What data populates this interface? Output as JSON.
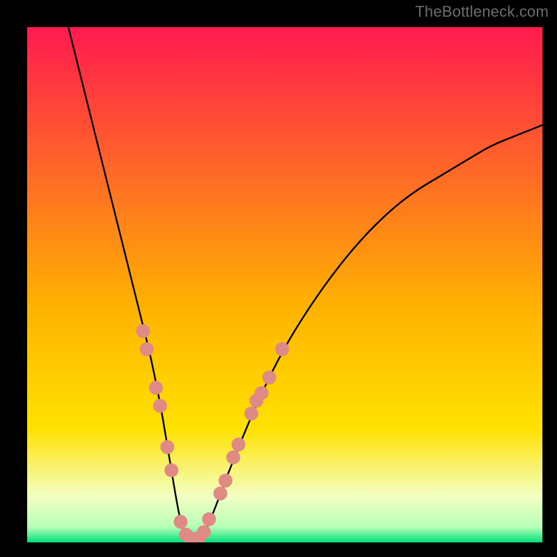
{
  "watermark": "TheBottleneck.com",
  "colors": {
    "frame": "#000000",
    "grad_top": "#ff1a4f",
    "grad_mid": "#ffe200",
    "grad_bottom1": "#e8ffb0",
    "grad_bottom2": "#00e07a",
    "curve": "#000000",
    "marker": "#e08a86"
  },
  "chart_data": {
    "type": "line",
    "title": "",
    "xlabel": "",
    "ylabel": "",
    "xlim": [
      0,
      100
    ],
    "ylim": [
      0,
      100
    ],
    "legend": false,
    "series": [
      {
        "name": "bottleneck-curve",
        "x": [
          8,
          10,
          12,
          14,
          16,
          18,
          20,
          22,
          24,
          26,
          27,
          28,
          29,
          30,
          31,
          32,
          33,
          34,
          35,
          37,
          40,
          45,
          50,
          55,
          60,
          65,
          70,
          75,
          80,
          85,
          90,
          95,
          100
        ],
        "y": [
          100,
          92,
          84,
          76,
          68,
          60,
          52,
          44,
          36,
          26,
          20,
          14,
          8,
          3,
          1,
          0.5,
          0.5,
          1,
          3,
          8,
          16,
          28,
          38,
          46,
          53,
          59,
          64,
          68,
          71,
          74,
          77,
          79,
          81
        ]
      }
    ],
    "markers": {
      "name": "highlight-dots",
      "color": "#e08a86",
      "points": [
        {
          "x": 22.5,
          "y": 41
        },
        {
          "x": 23.2,
          "y": 37.5
        },
        {
          "x": 25.0,
          "y": 30
        },
        {
          "x": 25.8,
          "y": 26.5
        },
        {
          "x": 27.2,
          "y": 18.5
        },
        {
          "x": 28.0,
          "y": 14
        },
        {
          "x": 29.8,
          "y": 4
        },
        {
          "x": 30.8,
          "y": 1.5
        },
        {
          "x": 32.0,
          "y": 0.7
        },
        {
          "x": 33.3,
          "y": 0.8
        },
        {
          "x": 34.3,
          "y": 2.0
        },
        {
          "x": 35.3,
          "y": 4.5
        },
        {
          "x": 37.5,
          "y": 9.5
        },
        {
          "x": 38.5,
          "y": 12
        },
        {
          "x": 40.0,
          "y": 16.5
        },
        {
          "x": 41.0,
          "y": 19
        },
        {
          "x": 43.5,
          "y": 25
        },
        {
          "x": 44.5,
          "y": 27.5
        },
        {
          "x": 45.5,
          "y": 29
        },
        {
          "x": 47.0,
          "y": 32
        },
        {
          "x": 49.5,
          "y": 37.5
        }
      ]
    }
  }
}
